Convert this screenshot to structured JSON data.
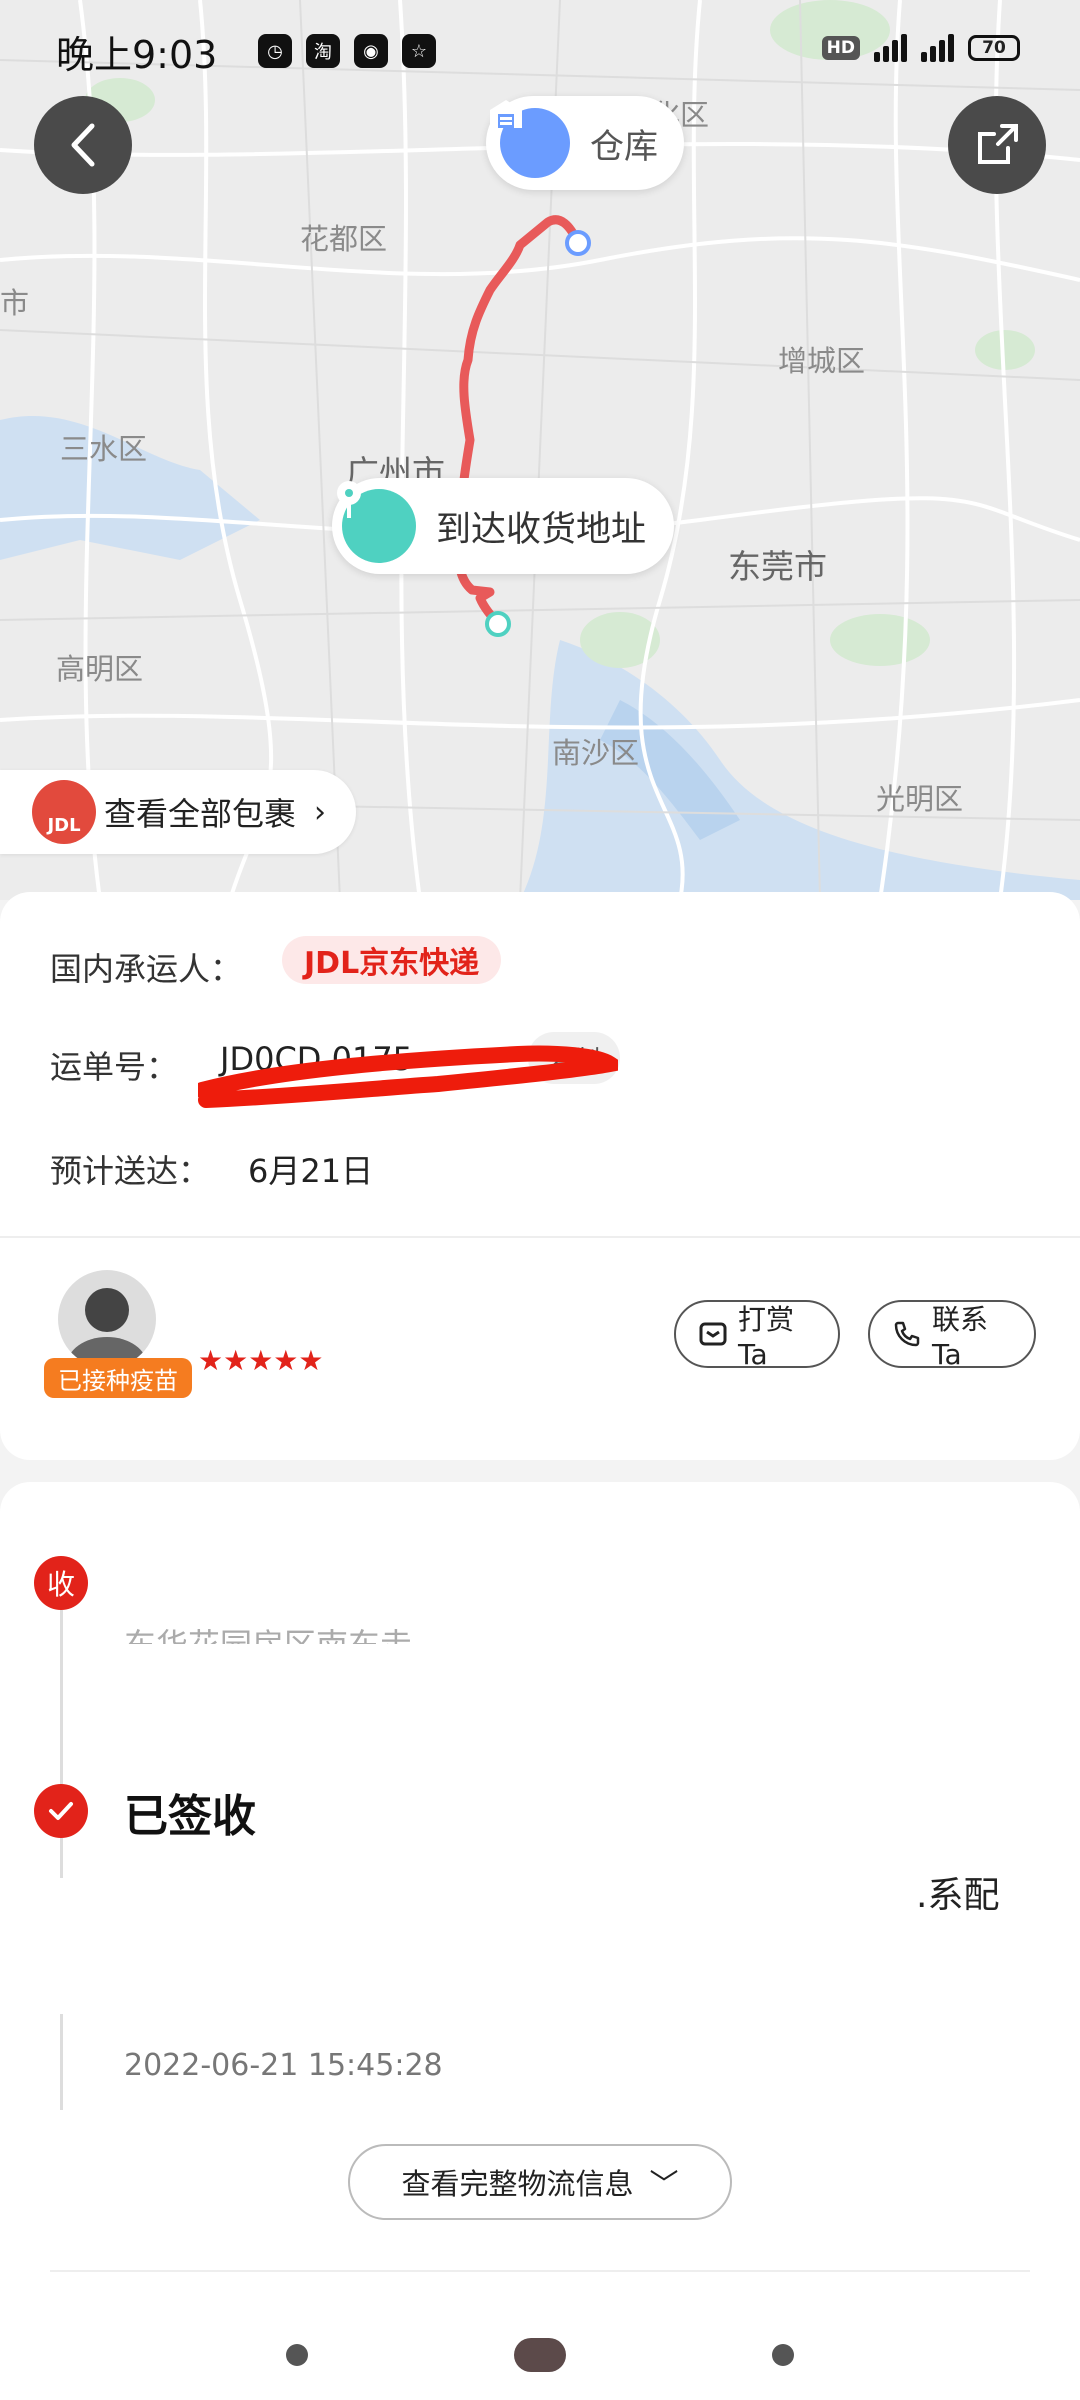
{
  "status_bar": {
    "time": "晚上9:03",
    "hd": "HD",
    "battery": "70",
    "dots": "··"
  },
  "map": {
    "labels": {
      "qingyuan": "清远市",
      "huadu": "花都区",
      "conghua": "从化区",
      "zengcheng": "增城区",
      "sanshui": "三水区",
      "guangzhou": "广州市",
      "dongguan": "东莞市",
      "gaoming": "高明区",
      "nansha": "南沙区",
      "guangming": "光明区",
      "shi": "市"
    },
    "warehouse_label": "仓库",
    "arrive_label": "到达收货地址",
    "route_color": "#e85a5a"
  },
  "all_packages": {
    "icon_text": "JDL",
    "label": "查看全部包裹",
    "chevron": "›"
  },
  "info": {
    "carrier_label": "国内承运人：",
    "carrier_name": "JDL京东快递",
    "waybill_label": "运单号：",
    "waybill_value": "JD0CD  0175",
    "copy_label": "复制",
    "eta_label": "预计送达：",
    "eta_value": "6月21日",
    "vaccine_badge": "已接种疫苗",
    "stars": "★★★★★",
    "tip_label": "打赏Ta",
    "contact_label": "联系Ta"
  },
  "timeline": {
    "receive_badge": "收",
    "receive_partial_text": "东华花园房区南东走",
    "signed_title": "已签收",
    "signed_partial_text": ".系配",
    "timestamp": "2022-06-21 15:45:28",
    "full_logistics_label": "查看完整物流信息",
    "chevron": "﹀"
  },
  "colors": {
    "accent_red": "#e2231a",
    "warehouse_blue": "#6b9cff",
    "arrive_teal": "#4fd1c1",
    "vaccine_orange": "#f57c20"
  }
}
